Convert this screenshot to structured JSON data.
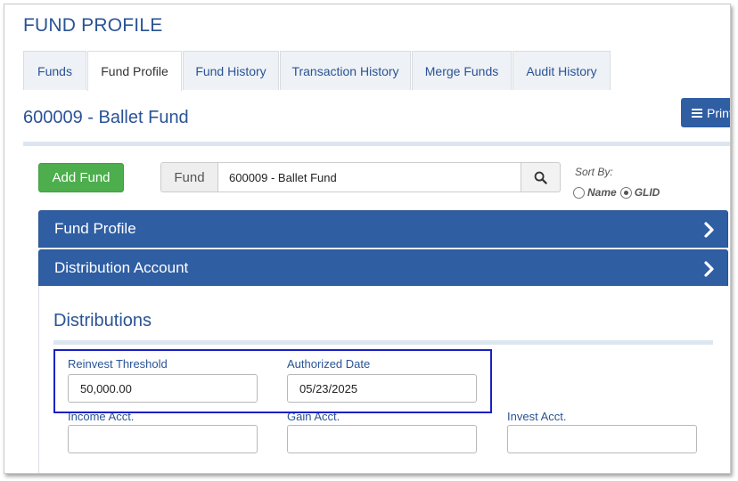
{
  "page": {
    "title": "FUND PROFILE"
  },
  "tabs": [
    {
      "label": "Funds",
      "active": false
    },
    {
      "label": "Fund Profile",
      "active": true
    },
    {
      "label": "Fund History",
      "active": false
    },
    {
      "label": "Transaction History",
      "active": false
    },
    {
      "label": "Merge Funds",
      "active": false
    },
    {
      "label": "Audit History",
      "active": false
    }
  ],
  "header": {
    "subtitle": "600009 - Ballet Fund",
    "print_label": "Print"
  },
  "toolbar": {
    "add_fund_label": "Add Fund",
    "fund_addon_label": "Fund",
    "fund_value": "600009 - Ballet Fund",
    "sort_by_label": "Sort By:",
    "sort_options": [
      {
        "label": "Name",
        "checked": false
      },
      {
        "label": "GLID",
        "checked": true
      }
    ]
  },
  "panels": [
    {
      "label": "Fund Profile"
    },
    {
      "label": "Distribution Account"
    }
  ],
  "distributions": {
    "title": "Distributions",
    "fields": {
      "reinvest_threshold": {
        "label": "Reinvest Threshold",
        "value": "50,000.00"
      },
      "authorized_date": {
        "label": "Authorized Date",
        "value": "05/23/2025"
      },
      "income_acct": {
        "label": "Income Acct.",
        "value": ""
      },
      "gain_acct": {
        "label": "Gain Acct.",
        "value": ""
      },
      "invest_acct": {
        "label": "Invest Acct.",
        "value": ""
      }
    }
  },
  "colors": {
    "brand_blue": "#2f5ea3",
    "success_green": "#4cae4c",
    "highlight_box": "#1a20c4"
  }
}
